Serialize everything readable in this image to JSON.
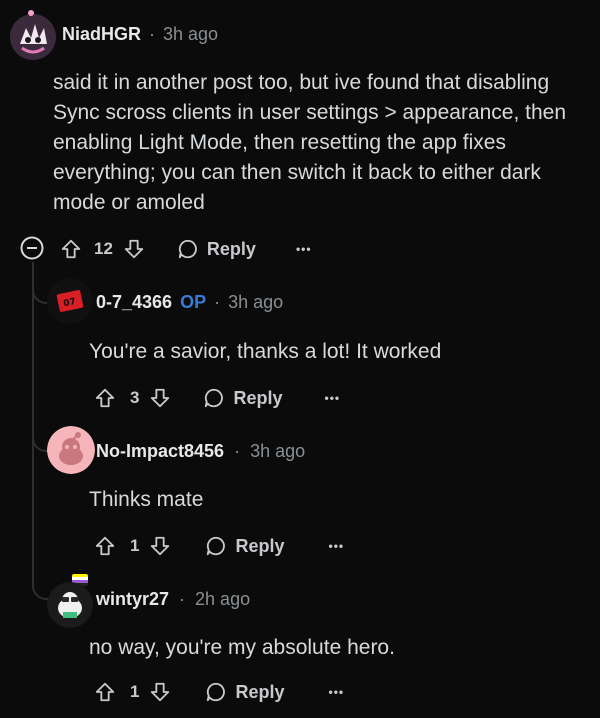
{
  "comments": [
    {
      "username": "NiadHGR",
      "time": "3h ago",
      "op_badge": "",
      "text_lines": [
        "said it in another post too, but ive found that disabling",
        "Sync scross clients in user settings > appearance, then",
        "enabling Light Mode, then resetting the app fixes",
        "everything; you can then switch it back to either dark",
        "mode or amoled"
      ],
      "votes": "12",
      "reply_label": "Reply",
      "more_label": "•••"
    },
    {
      "username": "0-7_4366",
      "time": "3h ago",
      "op_badge": "OP",
      "text": "You're a savior, thanks a lot! It worked",
      "votes": "3",
      "reply_label": "Reply",
      "more_label": "•••",
      "avatar_label": "07"
    },
    {
      "username": "No-Impact8456",
      "time": "3h ago",
      "text": "Thinks mate",
      "votes": "1",
      "reply_label": "Reply",
      "more_label": "•••"
    },
    {
      "username": "wintyr27",
      "time": "2h ago",
      "text": "no way, you're my absolute hero.",
      "votes": "1",
      "reply_label": "Reply",
      "more_label": "•••"
    }
  ],
  "separator": "·",
  "icons": {
    "collapse": "minus-circle-icon",
    "upvote": "arrow-up-outline-icon",
    "downvote": "arrow-down-outline-icon",
    "reply": "speech-bubble-icon"
  },
  "colors": {
    "background": "#0b0b0b",
    "op_badge": "#3a7bd5",
    "muted": "#8a8f93"
  }
}
